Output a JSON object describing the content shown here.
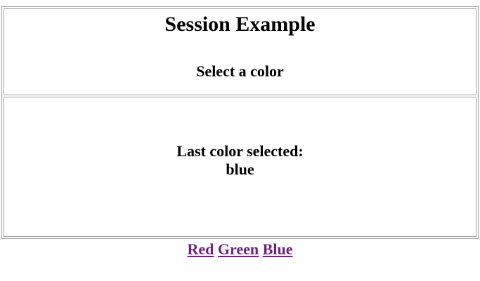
{
  "header": {
    "title": "Session Example",
    "subtitle": "Select a color"
  },
  "status": {
    "label": "Last color selected:",
    "value": "blue"
  },
  "color_links": [
    {
      "label": "Red"
    },
    {
      "label": "Green"
    },
    {
      "label": "Blue"
    }
  ],
  "colors": {
    "visited_link": "#6b2380",
    "border": "#a0a0a0",
    "text": "#000000",
    "background": "#ffffff"
  }
}
